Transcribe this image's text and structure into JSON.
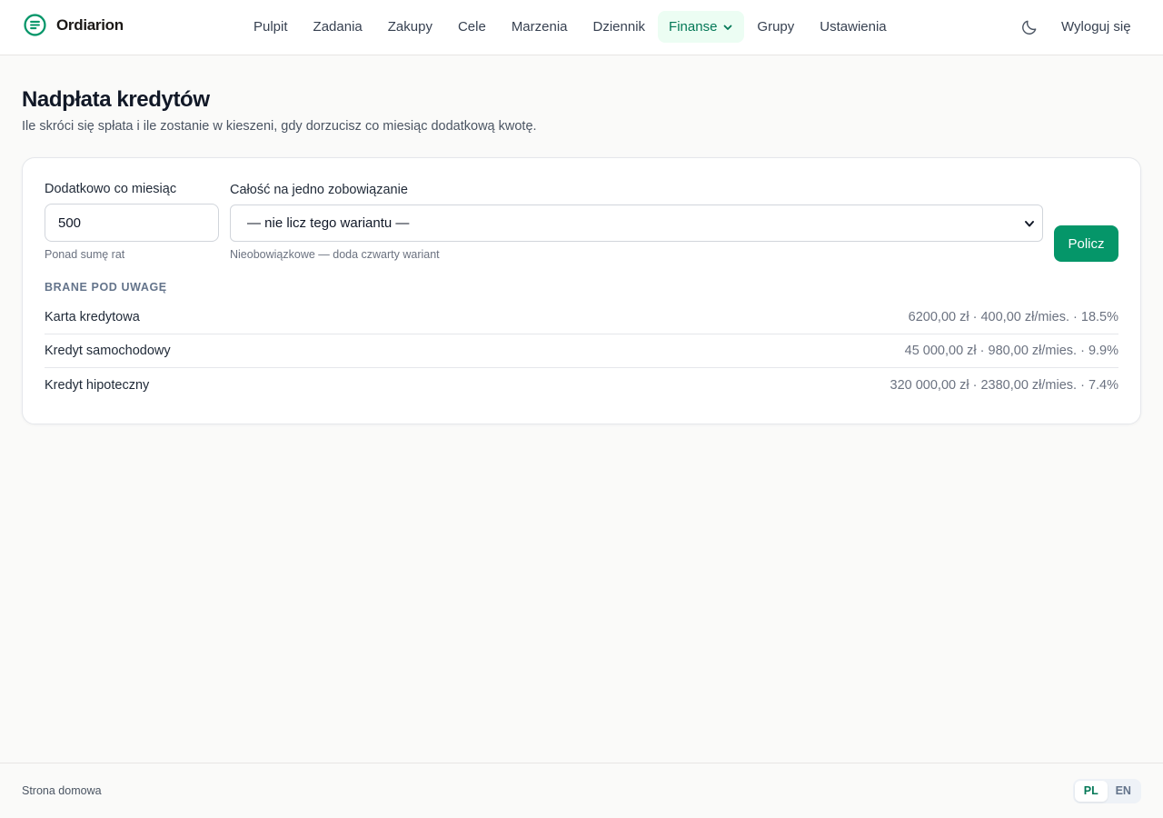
{
  "header": {
    "brand_name": "Ordiarion",
    "nav": [
      {
        "label": "Pulpit"
      },
      {
        "label": "Zadania"
      },
      {
        "label": "Zakupy"
      },
      {
        "label": "Cele"
      },
      {
        "label": "Marzenia"
      },
      {
        "label": "Dziennik"
      },
      {
        "label": "Finanse",
        "active": true
      },
      {
        "label": "Grupy"
      },
      {
        "label": "Ustawienia"
      }
    ],
    "theme_icon": "moon-icon",
    "logout_label": "Wyloguj się"
  },
  "page": {
    "title": "Nadpłata kredytów",
    "subtitle": "Ile skróci się spłata i ile zostanie w kieszeni, gdy dorzucisz co miesiąc dodatkową kwotę."
  },
  "form": {
    "extra_label": "Dodatkowo co miesiąc",
    "extra_value": "500",
    "extra_hint": "Ponad sumę rat",
    "single_label": "Całość na jedno zobowiązanie",
    "single_value": "— nie licz tego wariantu —",
    "single_hint": "Nieobowiązkowe — doda czwarty wariant",
    "calc_button": "Policz"
  },
  "debts": {
    "section_title": "BRANE POD UWAGĘ",
    "items": [
      {
        "name": "Karta kredytowa",
        "details": "6200,00 zł · 400,00 zł/mies. · 18.5%"
      },
      {
        "name": "Kredyt samochodowy",
        "details": "45 000,00 zł · 980,00 zł/mies. · 9.9%"
      },
      {
        "name": "Kredyt hipoteczny",
        "details": "320 000,00 zł · 2380,00 zł/mies. · 7.4%"
      }
    ]
  },
  "footer": {
    "home_link": "Strona domowa",
    "languages": [
      {
        "code": "PL",
        "active": true
      },
      {
        "code": "EN",
        "active": false
      }
    ]
  },
  "colors": {
    "accent": "#059669",
    "accent_text": "#047857",
    "active_bg": "#ecfdf3",
    "page_bg": "#fafaf9"
  }
}
